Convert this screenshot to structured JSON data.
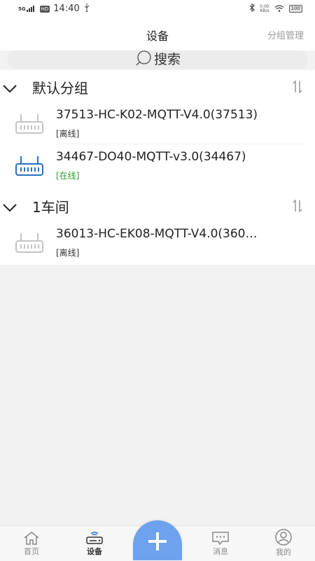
{
  "status_bar": {
    "network": "5G",
    "hd": "HD",
    "time": "14:40",
    "speed_value": "0.00",
    "speed_unit": "KB/s",
    "battery": "100"
  },
  "header": {
    "title": "设备",
    "group_manage": "分组管理"
  },
  "search": {
    "label": "搜索"
  },
  "groups": [
    {
      "name": "默认分组",
      "devices": [
        {
          "name": "37513-HC-K02-MQTT-V4.0(37513)",
          "status": "[离线]",
          "online": false
        },
        {
          "name": "34467-DO40-MQTT-v3.0(34467)",
          "status": "[在线]",
          "online": true
        }
      ]
    },
    {
      "name": "1车间",
      "devices": [
        {
          "name": "36013-HC-EK08-MQTT-V4.0(360…",
          "status": "[离线]",
          "online": false
        }
      ]
    }
  ],
  "colors": {
    "online": "#2e9b2e",
    "online_icon": "#2a6fc2",
    "offline_icon": "#c4c4c4",
    "fab": "#6ea2ee"
  },
  "tab_bar": {
    "tabs": [
      {
        "label": "首页",
        "icon": "home-icon"
      },
      {
        "label": "设备",
        "icon": "router-icon",
        "active": true
      },
      {
        "label": "消息",
        "icon": "message-icon"
      },
      {
        "label": "我的",
        "icon": "profile-icon"
      }
    ],
    "add_icon": "plus-icon"
  }
}
